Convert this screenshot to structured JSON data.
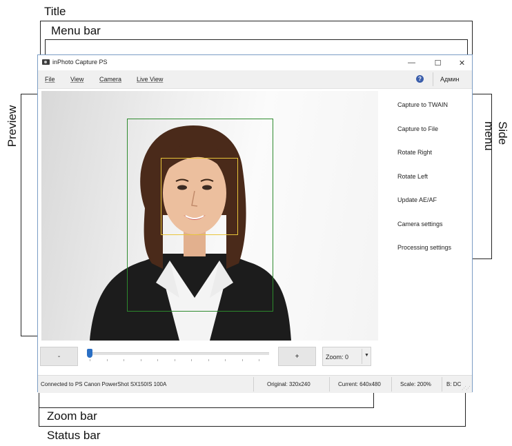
{
  "annotations": {
    "title": "Title",
    "menu_bar": "Menu bar",
    "preview": "Preview",
    "side_menu": "Side menu",
    "zoom_bar": "Zoom bar",
    "status_bar": "Status bar"
  },
  "window": {
    "title": "inPhoto Capture PS",
    "controls": {
      "minimize": "—",
      "maximize": "☐",
      "close": "✕"
    }
  },
  "menu": {
    "items": [
      "File",
      "View",
      "Camera",
      "Live View"
    ],
    "help_icon": "?",
    "user": "Админ"
  },
  "side_menu": {
    "items": [
      "Capture to TWAIN",
      "Capture to File",
      "Rotate Right",
      "Rotate Left",
      "Update AE/AF",
      "Camera settings",
      "Processing settings"
    ]
  },
  "zoom": {
    "minus_label": "-",
    "plus_label": "+",
    "combo_label": "Zoom: 0",
    "slider_value": 0
  },
  "status": {
    "connection": "Connected to PS Canon PowerShot SX150IS 100A",
    "original": "Original: 320x240",
    "current": "Current: 640x480",
    "scale": "Scale: 200%",
    "balance": "B: DC"
  },
  "colors": {
    "face_frame": "#2d8a2d",
    "eye_frame": "#e8c53a",
    "slider_thumb": "#2a6fc4",
    "window_border": "#7a9cc4"
  }
}
